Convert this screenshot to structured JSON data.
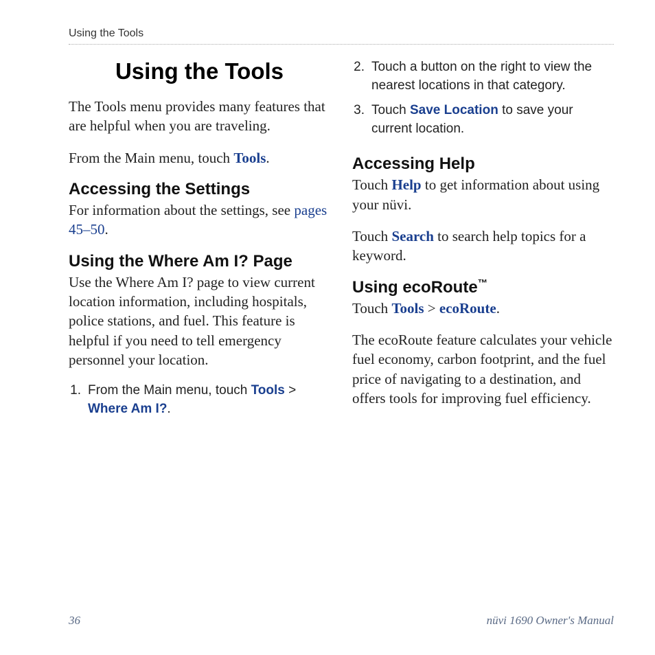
{
  "header": "Using the Tools",
  "left": {
    "title": "Using the Tools",
    "intro": "The Tools menu provides many features that are helpful when you are traveling.",
    "from_main_prefix": "From the Main menu, touch ",
    "tools_label": "Tools",
    "period": ".",
    "settings_heading": "Accessing the Settings",
    "settings_body_prefix": "For information about the settings, see ",
    "pages_link": "pages 45–50",
    "whereami_heading": "Using the Where Am I? Page",
    "whereami_body": "Use the Where Am I? page to view current location information, including hospitals, police stations, and fuel. This feature is helpful if you need to tell emergency personnel your location.",
    "step1_num": "1.",
    "step1_prefix": "From the Main menu, touch ",
    "step1_tools": "Tools",
    "step1_gt": " > ",
    "step1_whereami": "Where Am I?"
  },
  "right": {
    "step2_num": "2.",
    "step2_text": "Touch a button on the right to view the nearest locations in that category.",
    "step3_num": "3.",
    "step3_prefix": "Touch ",
    "step3_save": "Save Location",
    "step3_suffix": " to save your current location.",
    "help_heading": "Accessing Help",
    "help_body_prefix": "Touch ",
    "help_label": "Help",
    "help_body_suffix": " to get information about using your nüvi.",
    "search_prefix": "Touch ",
    "search_label": "Search",
    "search_suffix": " to search help topics for a keyword.",
    "eco_heading": "Using ecoRoute",
    "tm": "™",
    "eco_touch_prefix": "Touch ",
    "eco_tools": "Tools",
    "eco_gt": " > ",
    "eco_label": "ecoRoute",
    "eco_body": "The ecoRoute feature calculates your vehicle fuel economy, carbon footprint, and the fuel price of navigating to a destination, and offers tools for improving fuel efficiency."
  },
  "footer": {
    "page": "36",
    "manual": "nüvi 1690 Owner's Manual"
  }
}
